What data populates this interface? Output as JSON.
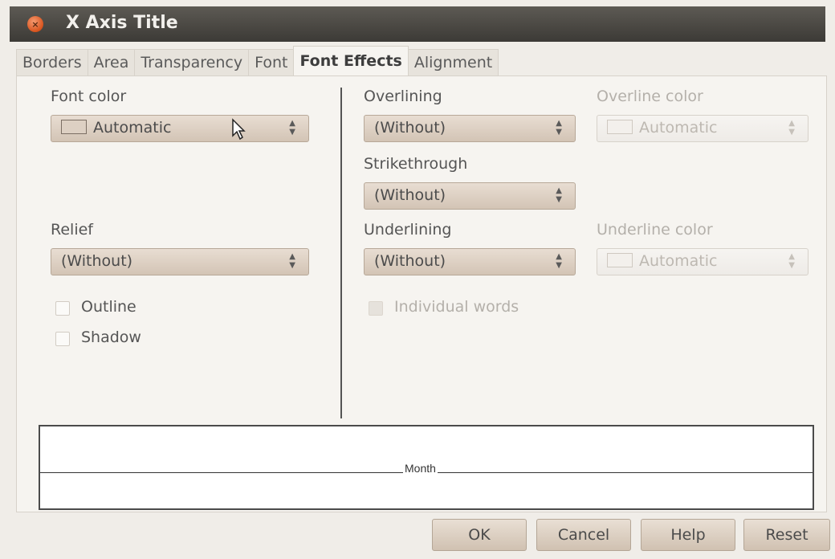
{
  "window": {
    "title": "X Axis Title"
  },
  "tabs": [
    {
      "label": "Borders"
    },
    {
      "label": "Area"
    },
    {
      "label": "Transparency"
    },
    {
      "label": "Font"
    },
    {
      "label": "Font Effects"
    },
    {
      "label": "Alignment"
    }
  ],
  "left": {
    "font_color": {
      "label": "Font color",
      "value": "Automatic"
    },
    "relief": {
      "label": "Relief",
      "value": "(Without)"
    },
    "outline": {
      "label": "Outline"
    },
    "shadow": {
      "label": "Shadow"
    }
  },
  "right": {
    "overlining": {
      "label": "Overlining",
      "value": "(Without)"
    },
    "overline_color": {
      "label": "Overline color",
      "value": "Automatic"
    },
    "strikethrough": {
      "label": "Strikethrough",
      "value": "(Without)"
    },
    "underlining": {
      "label": "Underlining",
      "value": "(Without)"
    },
    "underline_color": {
      "label": "Underline color",
      "value": "Automatic"
    },
    "individual_words": {
      "label": "Individual words"
    }
  },
  "preview": {
    "text": "Month"
  },
  "buttons": {
    "ok": "OK",
    "cancel": "Cancel",
    "help": "Help",
    "reset": "Reset"
  }
}
